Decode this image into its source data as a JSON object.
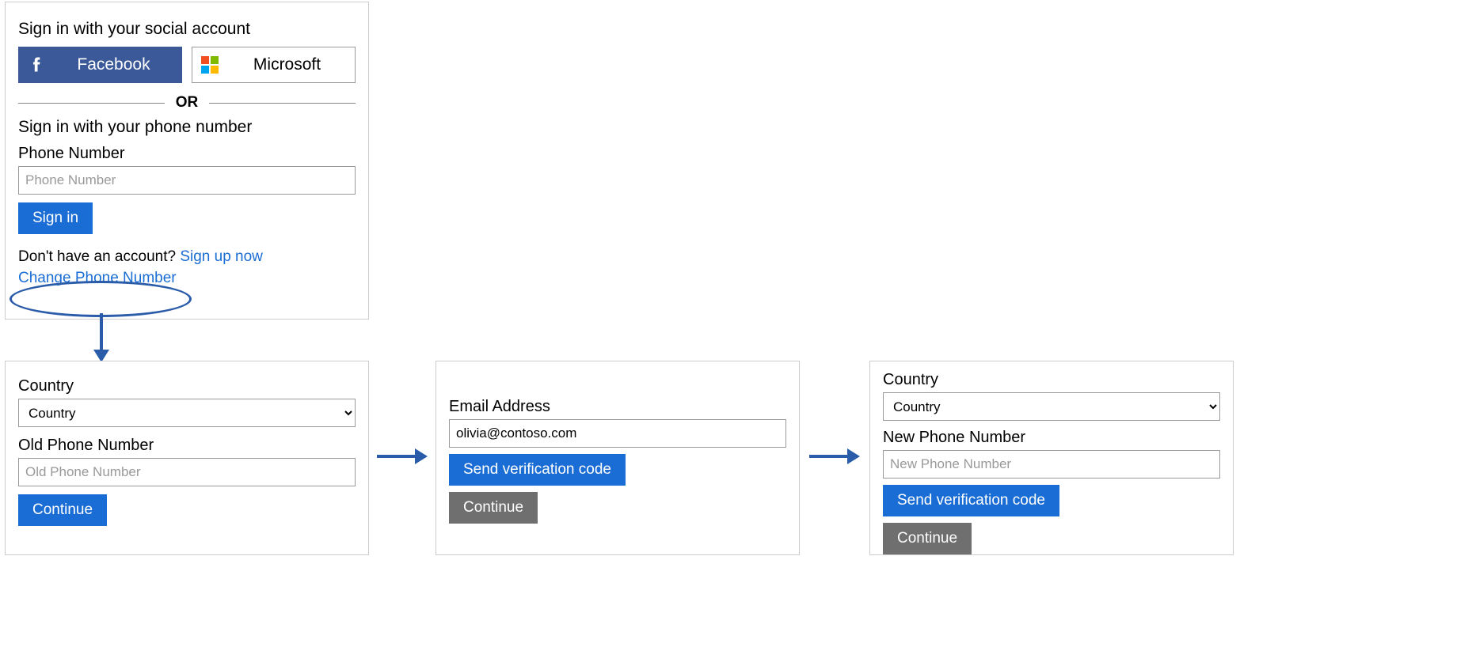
{
  "signin": {
    "social_heading": "Sign in with your social account",
    "facebook_label": "Facebook",
    "microsoft_label": "Microsoft",
    "or_text": "OR",
    "phone_heading": "Sign in with your phone number",
    "phone_label": "Phone Number",
    "phone_placeholder": "Phone Number",
    "signin_button": "Sign in",
    "no_account_text": "Don't have an account? ",
    "signup_link": "Sign up now",
    "change_phone_link": "Change Phone Number"
  },
  "step1": {
    "country_label": "Country",
    "country_value": "Country",
    "old_phone_label": "Old Phone Number",
    "old_phone_placeholder": "Old Phone Number",
    "continue_button": "Continue"
  },
  "step2": {
    "email_label": "Email Address",
    "email_value": "olivia@contoso.com",
    "send_code_button": "Send verification code",
    "continue_button": "Continue"
  },
  "step3": {
    "country_label": "Country",
    "country_value": "Country",
    "new_phone_label": "New Phone Number",
    "new_phone_placeholder": "New Phone Number",
    "send_code_button": "Send verification code",
    "continue_button": "Continue"
  }
}
